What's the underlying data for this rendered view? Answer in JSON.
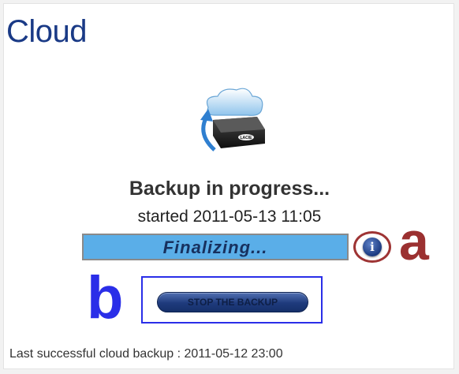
{
  "panel": {
    "title": "Cloud"
  },
  "status": {
    "heading": "Backup in progress...",
    "started": "started 2011-05-13 11:05",
    "progress_label": "Finalizing...",
    "progress_fraction": 1.0
  },
  "device": {
    "brand_label": "LACIE"
  },
  "info_button": {
    "symbol": "i"
  },
  "actions": {
    "stop_label": "STOP THE BACKUP"
  },
  "annotations": {
    "a": "a",
    "b": "b"
  },
  "footer": {
    "last_backup": "Last successful cloud backup : 2011-05-12 23:00"
  },
  "colors": {
    "title": "#1a3a86",
    "progress_fill": "#5aaee8",
    "annotation_a": "#9b3030",
    "annotation_b": "#2a2ee8"
  },
  "icons": {
    "device": "cloud-backup-device-icon",
    "info": "info-icon"
  }
}
